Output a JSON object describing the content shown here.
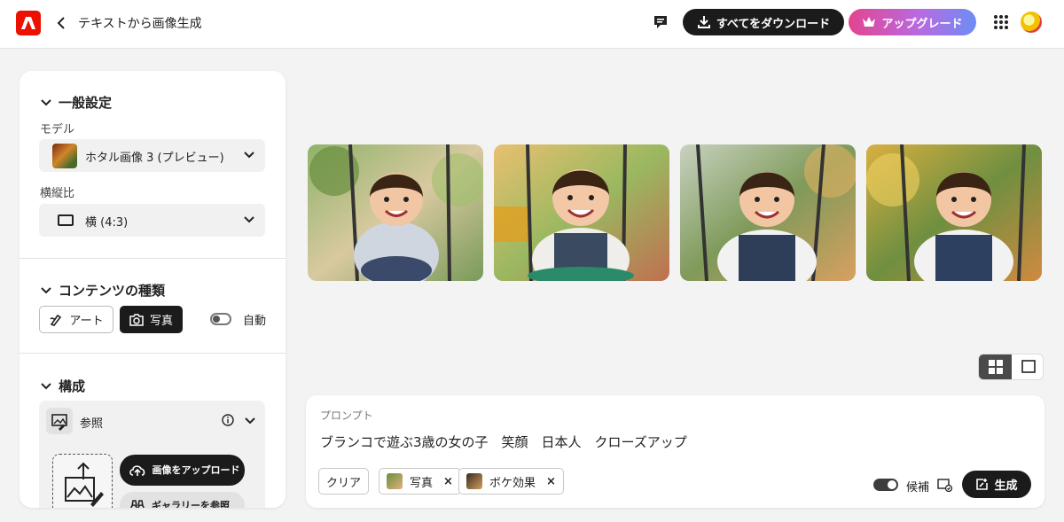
{
  "header": {
    "title": "テキストから画像生成",
    "download_label": "すべてをダウンロード",
    "upgrade_label": "アップグレード"
  },
  "panel": {
    "general": {
      "heading": "一般設定",
      "model_label": "モデル",
      "model_value": "ホタル画像 3 (プレビュー)",
      "ratio_label": "横縦比",
      "ratio_value": "横 (4:3)"
    },
    "content_type": {
      "heading": "コンテンツの種類",
      "art_label": "アート",
      "photo_label": "写真",
      "auto_label": "自動"
    },
    "composition": {
      "heading": "構成",
      "reference_label": "参照",
      "upload_label": "画像をアップロード",
      "gallery_label": "ギャラリーを参照"
    }
  },
  "images": [
    {
      "name": "generated-image-1"
    },
    {
      "name": "generated-image-2"
    },
    {
      "name": "generated-image-3"
    },
    {
      "name": "generated-image-4"
    }
  ],
  "prompt": {
    "label": "プロンプト",
    "text": "ブランコで遊ぶ3歳の女の子　笑顔　日本人　クローズアップ",
    "clear_label": "クリア",
    "chips": [
      "写真",
      "ボケ効果"
    ],
    "candidate_label": "候補",
    "generate_label": "生成"
  },
  "colors": {
    "accent_dark": "#1b1b1b",
    "adobe_red": "#eb1000",
    "upgrade_gradient_start": "#e4448f",
    "upgrade_gradient_end": "#6d8df5"
  }
}
